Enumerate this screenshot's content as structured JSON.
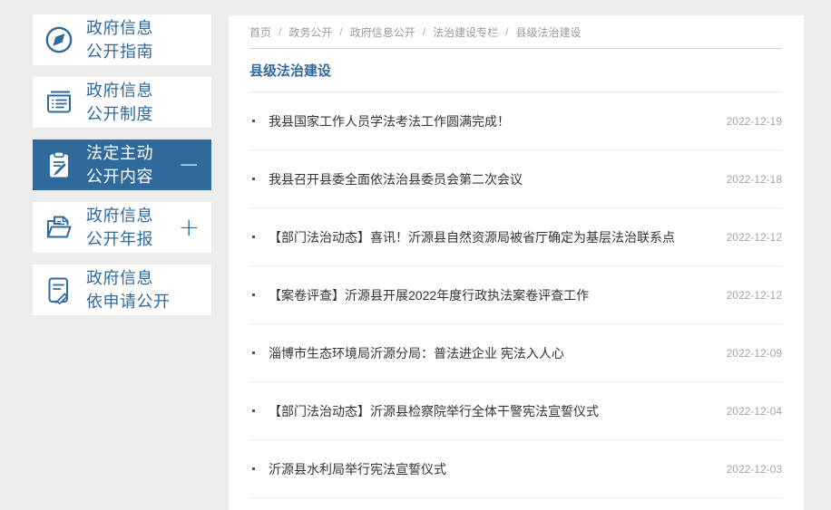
{
  "colors": {
    "accent": "#306a9d",
    "text_dark": "#333333",
    "muted": "#9a9a9a"
  },
  "sidebar": {
    "items": [
      {
        "line1": "政府信息",
        "line2": "公开指南",
        "icon": "compass-icon",
        "active": false,
        "toggle": ""
      },
      {
        "line1": "政府信息",
        "line2": "公开制度",
        "icon": "document-list-icon",
        "active": false,
        "toggle": ""
      },
      {
        "line1": "法定主动",
        "line2": "公开内容",
        "icon": "clipboard-pencil-icon",
        "active": true,
        "toggle": "−"
      },
      {
        "line1": "政府信息",
        "line2": "公开年报",
        "icon": "folder-document-icon",
        "active": false,
        "toggle": "+"
      },
      {
        "line1": "政府信息",
        "line2": "依申请公开",
        "icon": "document-edit-icon",
        "active": false,
        "toggle": ""
      }
    ]
  },
  "breadcrumb": {
    "separator": "/",
    "items": [
      "首页",
      "政务公开",
      "政府信息公开",
      "法治建设专栏",
      "县级法治建设"
    ]
  },
  "main": {
    "title": "县级法治建设",
    "articles": [
      {
        "title": "我县国家工作人员学法考法工作圆满完成！",
        "date": "2022-12-19"
      },
      {
        "title": "我县召开县委全面依法治县委员会第二次会议",
        "date": "2022-12-18"
      },
      {
        "title": "【部门法治动态】喜讯！沂源县自然资源局被省厅确定为基层法治联系点",
        "date": "2022-12-12"
      },
      {
        "title": "【案卷评查】沂源县开展2022年度行政执法案卷评查工作",
        "date": "2022-12-12"
      },
      {
        "title": "淄博市生态环境局沂源分局：普法进企业 宪法入人心",
        "date": "2022-12-09"
      },
      {
        "title": "【部门法治动态】沂源县检察院举行全体干警宪法宣誓仪式",
        "date": "2022-12-04"
      },
      {
        "title": "沂源县水利局举行宪法宣誓仪式",
        "date": "2022-12-03"
      }
    ]
  }
}
